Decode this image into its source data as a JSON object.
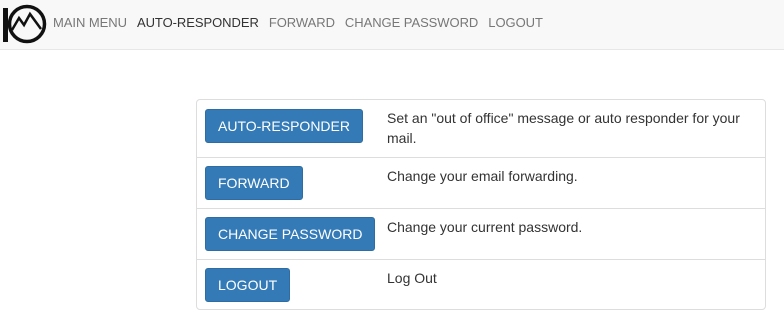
{
  "nav": {
    "items": [
      {
        "label": "MAIN MENU",
        "active": false
      },
      {
        "label": "AUTO-RESPONDER",
        "active": true
      },
      {
        "label": "FORWARD",
        "active": false
      },
      {
        "label": "CHANGE PASSWORD",
        "active": false
      },
      {
        "label": "LOGOUT",
        "active": false
      }
    ]
  },
  "rows": [
    {
      "button": "AUTO-RESPONDER",
      "description": "Set an \"out of office\" message or auto responder for your mail."
    },
    {
      "button": "FORWARD",
      "description": "Change your email forwarding."
    },
    {
      "button": "CHANGE PASSWORD",
      "description": "Change your current password."
    },
    {
      "button": "LOGOUT",
      "description": "Log Out"
    }
  ],
  "colors": {
    "button_primary": "#337ab7",
    "navbar_bg": "#f8f8f8",
    "nav_text": "#777777",
    "nav_active_text": "#333333"
  }
}
